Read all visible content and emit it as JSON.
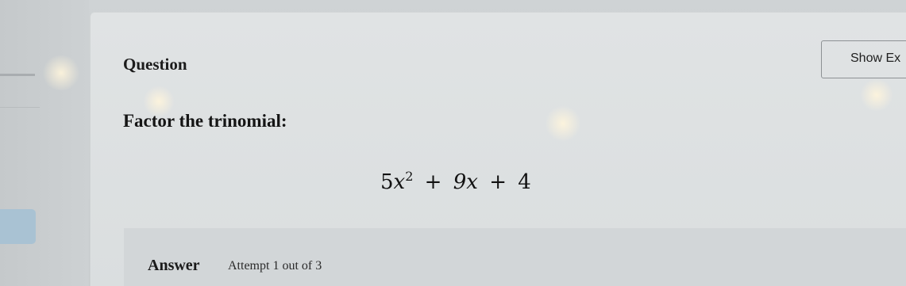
{
  "question": {
    "title": "Question",
    "show_button_label": "Show Ex",
    "prompt": "Factor the trinomial:",
    "expression": {
      "coefficient_a": "5",
      "variable": "x",
      "exponent": "2",
      "plus_1": "+",
      "term_b": "9x",
      "plus_2": "+",
      "constant": "4"
    }
  },
  "answer": {
    "label": "Answer",
    "attempt_text": "Attempt 1 out of 3"
  },
  "colors": {
    "panel_bg": "#dfe2e3",
    "answer_bg": "#d2d6d8",
    "rail_tab": "#a9c2d3",
    "text": "#1a1a1a"
  }
}
